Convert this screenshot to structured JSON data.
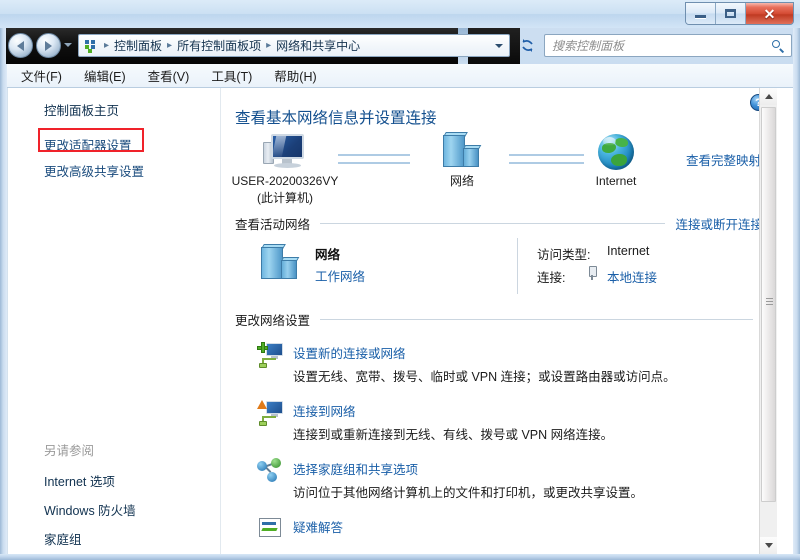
{
  "window": {
    "controls": {
      "minimize_label": "–",
      "maximize_label": "",
      "close_label": "✕"
    }
  },
  "addressbar": {
    "breadcrumbs": [
      "控制面板",
      "所有控制面板项",
      "网络和共享中心"
    ],
    "separator": "▸",
    "refresh_label": "↺"
  },
  "search": {
    "placeholder": "搜索控制面板",
    "value": ""
  },
  "menubar": {
    "items": [
      "文件(F)",
      "编辑(E)",
      "查看(V)",
      "工具(T)",
      "帮助(H)"
    ]
  },
  "sidebar": {
    "home_label": "控制面板主页",
    "links": [
      "更改适配器设置",
      "更改高级共享设置"
    ],
    "highlight_color": "#f0222a",
    "see_also_title": "另请参阅",
    "see_also": [
      "Internet 选项",
      "Windows 防火墙",
      "家庭组"
    ]
  },
  "content": {
    "help_label": "?",
    "title": "查看基本网络信息并设置连接",
    "netmap": {
      "view_full_map": "查看完整映射",
      "nodes": [
        {
          "icon": "computer-icon",
          "label_line1": "USER-20200326VY",
          "label_line2": "(此计算机)"
        },
        {
          "icon": "network-server-icon",
          "label_line1": "网络",
          "label_line2": ""
        },
        {
          "icon": "globe-internet-icon",
          "label_line1": "Internet",
          "label_line2": ""
        }
      ]
    },
    "active_networks": {
      "title": "查看活动网络",
      "action": "连接或断开连接",
      "network_name": "网络",
      "network_type": "工作网络",
      "access_label": "访问类型:",
      "access_value": "Internet",
      "connection_label": "连接:",
      "connection_value": "本地连接"
    },
    "change_settings": {
      "title": "更改网络设置",
      "items": [
        {
          "icon": "new-connection-icon",
          "link": "设置新的连接或网络",
          "desc": "设置无线、宽带、拨号、临时或 VPN 连接；或设置路由器或访问点。"
        },
        {
          "icon": "connect-to-network-icon",
          "link": "连接到网络",
          "desc": "连接到或重新连接到无线、有线、拨号或 VPN 网络连接。"
        },
        {
          "icon": "homegroup-sharing-icon",
          "link": "选择家庭组和共享选项",
          "desc": "访问位于其他网络计算机上的文件和打印机，或更改共享设置。"
        },
        {
          "icon": "troubleshoot-icon",
          "link": "疑难解答",
          "desc": ""
        }
      ]
    }
  },
  "scrollbar": {
    "up_label": "▲",
    "down_label": "▼"
  }
}
